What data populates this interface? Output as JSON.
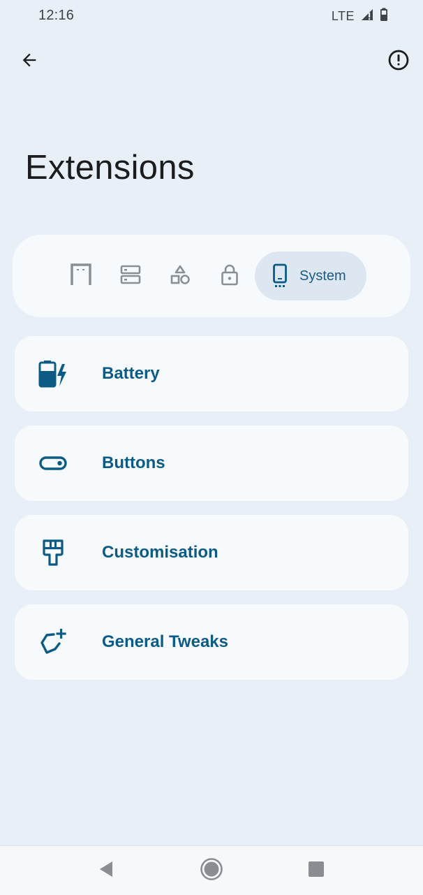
{
  "status_bar": {
    "time": "12:16",
    "network": "LTE"
  },
  "app_bar": {
    "back_icon": "arrow-back-icon",
    "info_icon": "info-outline-icon"
  },
  "page": {
    "title": "Extensions"
  },
  "categories": {
    "items": [
      {
        "icon": "door-frame-icon",
        "selected": false
      },
      {
        "icon": "server-stack-icon",
        "selected": false
      },
      {
        "icon": "shapes-icon",
        "selected": false
      },
      {
        "icon": "lock-icon",
        "selected": false
      },
      {
        "icon": "phone-icon",
        "selected": true,
        "label": "System"
      }
    ]
  },
  "extensions": [
    {
      "label": "Battery",
      "icon": "battery-charging-icon"
    },
    {
      "label": "Buttons",
      "icon": "toggle-icon"
    },
    {
      "label": "Customisation",
      "icon": "paint-brush-icon"
    },
    {
      "label": "General Tweaks",
      "icon": "shield-plus-icon"
    }
  ],
  "colors": {
    "background": "#e9eff7",
    "card": "#f7fafd",
    "accent": "#0c5b84",
    "selected_chip": "#dce7f2",
    "inactive_icon": "#8a8f96"
  },
  "nav": {
    "back_icon": "nav-back-icon",
    "home_icon": "nav-home-icon",
    "recents_icon": "nav-recents-icon"
  }
}
